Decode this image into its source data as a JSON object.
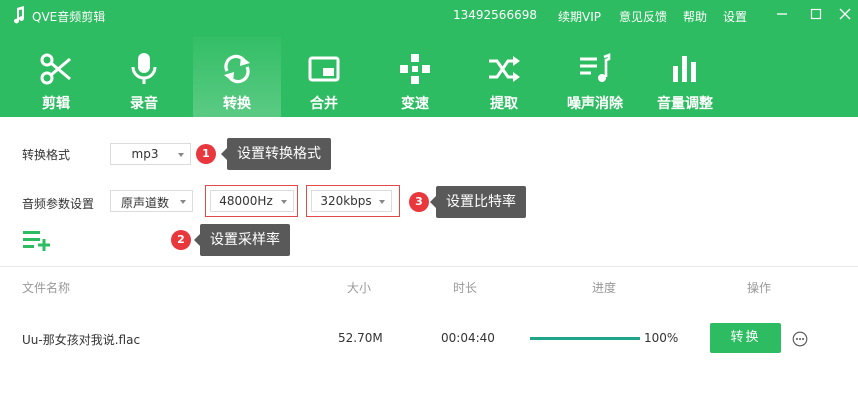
{
  "app": {
    "title": "QVE音频剪辑",
    "phone": "13492566698",
    "menu": {
      "vip": "续期VIP",
      "feedback": "意见反馈",
      "help": "帮助",
      "settings": "设置"
    }
  },
  "tabs": [
    {
      "label": "剪辑",
      "icon": "scissors-icon"
    },
    {
      "label": "录音",
      "icon": "microphone-icon"
    },
    {
      "label": "转换",
      "icon": "convert-icon",
      "active": true
    },
    {
      "label": "合并",
      "icon": "merge-icon"
    },
    {
      "label": "变速",
      "icon": "speed-icon"
    },
    {
      "label": "提取",
      "icon": "extract-icon"
    },
    {
      "label": "噪声消除",
      "icon": "noise-removal-icon"
    },
    {
      "label": "音量调整",
      "icon": "volume-bars-icon"
    }
  ],
  "settings": {
    "format_label": "转换格式",
    "format_value": "mp3",
    "params_label": "音频参数设置",
    "channel_value": "原声道数",
    "sample_rate_value": "48000Hz",
    "bitrate_value": "320kbps"
  },
  "tips": [
    {
      "number": "1",
      "text": "设置转换格式"
    },
    {
      "number": "2",
      "text": "设置采样率"
    },
    {
      "number": "3",
      "text": "设置比特率"
    }
  ],
  "table": {
    "headers": {
      "name": "文件名称",
      "size": "大小",
      "duration": "时长",
      "progress": "进度",
      "action": "操作"
    },
    "rows": [
      {
        "name": "Uu-那女孩对我说.flac",
        "size": "52.70M",
        "duration": "00:04:40",
        "progress": 1.0,
        "progress_text": "100%",
        "action_label": "转换"
      }
    ]
  },
  "colors": {
    "brand": "#2dbc61",
    "badge": "#e8383d",
    "tooltip": "#595959",
    "progress": "#1fa58a"
  }
}
